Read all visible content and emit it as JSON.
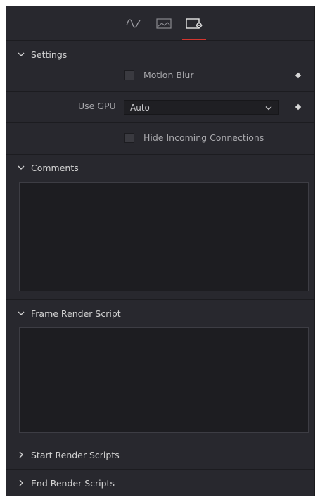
{
  "tabs": [
    {
      "name": "curve-icon",
      "selected": false
    },
    {
      "name": "image-icon",
      "selected": false
    },
    {
      "name": "settings-icon",
      "selected": true
    }
  ],
  "colors": {
    "accent": "#d4362f",
    "panel_bg": "#28282e",
    "field_bg": "#1d1d21",
    "text": "#c8c8c8"
  },
  "settings": {
    "title": "Settings",
    "motion_blur_label": "Motion Blur",
    "motion_blur_checked": false,
    "use_gpu_label": "Use GPU",
    "use_gpu_value": "Auto",
    "hide_incoming_label": "Hide Incoming Connections",
    "hide_incoming_checked": false
  },
  "comments": {
    "title": "Comments",
    "value": ""
  },
  "frame_render_script": {
    "title": "Frame Render Script",
    "value": ""
  },
  "start_render_scripts": {
    "title": "Start Render Scripts"
  },
  "end_render_scripts": {
    "title": "End Render Scripts"
  }
}
